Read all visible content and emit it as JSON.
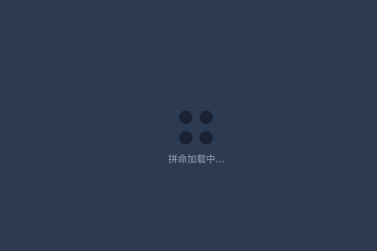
{
  "loading": {
    "text": "拼命加载中...",
    "icon": "loading-dots-icon",
    "colors": {
      "background": "#2c3a52",
      "dots": "#1a2233",
      "text": "#9aa4b3"
    }
  }
}
